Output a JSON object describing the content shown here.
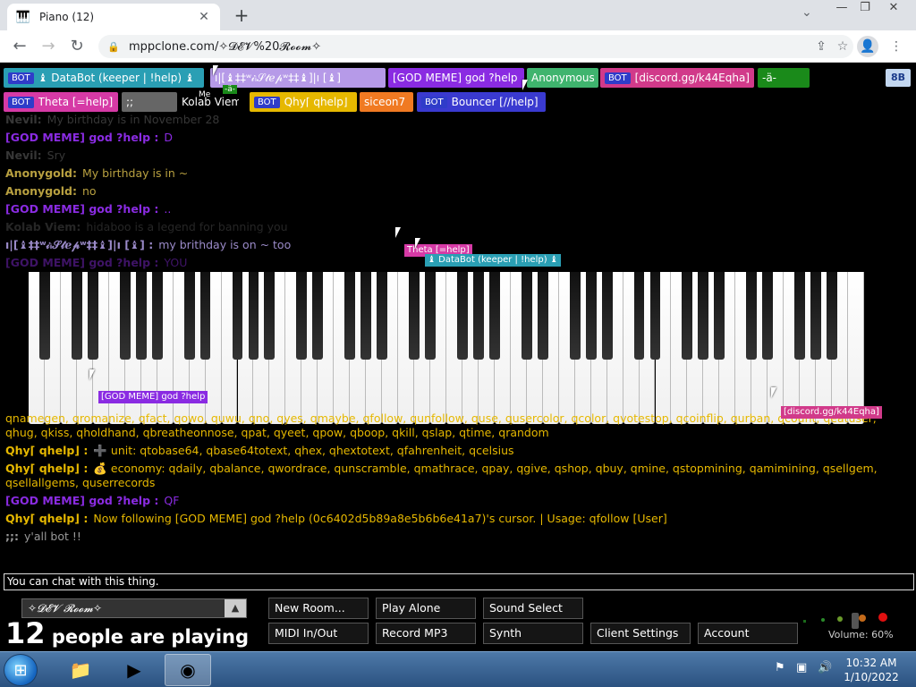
{
  "browser": {
    "tab_title": "Piano (12)",
    "url": "mppclone.com/✧𝓓𝓔𝓥%20𝓡𝓸𝓸𝓶✧"
  },
  "users": [
    {
      "bot": "BOT",
      "label": "♝ DataBot (keeper | !help) ♝",
      "color": "#2a9fb4"
    },
    {
      "bot": "",
      "label": "ı|[♝‡‡ʷ𝒾ᵢ𝒮𝓉ℯ𝓅ʷ‡‡♝]|ı [♝]",
      "color": "#b69ae8"
    },
    {
      "bot": "",
      "label": "[GOD MEME] god ?help",
      "color": "#8a2be2"
    },
    {
      "bot": "",
      "label": "Anonymous",
      "color": "#3fb46e"
    },
    {
      "bot": "BOT",
      "label": "[discord.gg/k44Eqha]",
      "color": "#d13a8a"
    },
    {
      "bot": "",
      "label": "-ä-",
      "color": "#1a8a1a"
    },
    {
      "bot": "BOT",
      "label": "Theta [=help]",
      "color": "#d63aa6"
    },
    {
      "bot": "",
      "label": ";;",
      "color": "#666666"
    },
    {
      "bot": "",
      "label": "Kolab Viem",
      "color": "#000000"
    },
    {
      "bot": "BOT",
      "label": "Qhy⌈ qhelp⌋",
      "color": "#e6b800"
    },
    {
      "bot": "",
      "label": "siceon7",
      "color": "#f07a22"
    },
    {
      "bot": "BOT",
      "label": "Bouncer [//help]",
      "color": "#3a3ad0"
    }
  ],
  "small_badges": {
    "me": "Me",
    "a": "-ä-",
    "sb": "8B"
  },
  "chat": [
    {
      "name": "Nevil:",
      "text": "My birthday is in November 28",
      "color": "#7a7a7a",
      "fade": true
    },
    {
      "name": "[GOD MEME] god ?help :",
      "text": "D",
      "color": "#8a2be2",
      "fade": false
    },
    {
      "name": "Nevil:",
      "text": "Sry",
      "color": "#7a7a7a",
      "fade": true
    },
    {
      "name": "Anonygold:",
      "text": "My birthday is in ~",
      "color": "#b8a040",
      "fade": false
    },
    {
      "name": "Anonygold:",
      "text": "no",
      "color": "#b8a040",
      "fade": false
    },
    {
      "name": "[GOD MEME] god ?help :",
      "text": "..",
      "color": "#8a2be2",
      "fade": false
    },
    {
      "name": "Kolab Viem:",
      "text": "hidaboo is a legend for banning you",
      "color": "#555555",
      "fade": true
    },
    {
      "name": "ı|[♝‡‡ʷ𝒾ᵢ𝒮𝓉ℯ𝓅ʷ‡‡♝]|ı [♝] :",
      "text": "my brithday is on ~ too",
      "color": "#9a8ac8",
      "fade": false
    },
    {
      "name": "[GOD MEME] god ?help :",
      "text": "YOU",
      "color": "#8a2be2",
      "fade": true
    }
  ],
  "chat_lower": [
    {
      "name": "",
      "text": "qnamegen, qromanize, qfact, qowo, quwu, qno, qyes, qmaybe, qfollow, qunfollow, quse, qusercolor, qcolor, qvotestop, qcoinflip, qurban, qcount, qeatuser, qhug, qkiss, qholdhand, qbreatheonnose, qpat, qyeet, qpow, qboop, qkill, qslap, qtime, qrandom",
      "color": "#e6b800",
      "wrap": true
    },
    {
      "name": "Qhy⌈ qhelp⌋ :",
      "text": "➕ unit: qtobase64, qbase64totext, qhex, qhextotext, qfahrenheit, qcelsius",
      "color": "#e6b800",
      "wrap": false
    },
    {
      "name": "Qhy⌈ qhelp⌋ :",
      "text": "💰 economy: qdaily, qbalance, qwordrace, qunscramble, qmathrace, qpay, qgive, qshop, qbuy, qmine, qstopmining, qamimining, qsellgem, qsellallgems, quserrecords",
      "color": "#e6b800",
      "wrap": true
    },
    {
      "name": "[GOD MEME] god ?help :",
      "text": "QF",
      "color": "#8a2be2",
      "wrap": false
    },
    {
      "name": "Qhy⌈ qhelp⌋ :",
      "text": "Now following [GOD MEME] god ?help (0c6402d5b89a8e5b6b6e41a7)'s cursor. | Usage: qfollow [User]",
      "color": "#e6b800",
      "wrap": false
    },
    {
      "name": ";;:",
      "text": "y'all bot !!",
      "color": "#999999",
      "wrap": false
    }
  ],
  "cursors": [
    {
      "label": "Theta [=help]",
      "color": "#d63aa6"
    },
    {
      "label": "♝ DataBot (keeper | !help) ♝",
      "color": "#2a9fb4"
    },
    {
      "label": "[GOD MEME] god ?help",
      "color": "#8a2be2"
    },
    {
      "label": "[discord.gg/k44Eqha]",
      "color": "#d13a8a"
    }
  ],
  "chat_input_placeholder": "You can chat with this thing.",
  "room": {
    "name": "✧𝓓𝓔𝓥 𝓡𝓸𝓸𝓶✧",
    "playing_count": "12",
    "playing_text": "people are playing"
  },
  "buttons": {
    "new_room": "New Room...",
    "play_alone": "Play Alone",
    "sound_select": "Sound Select",
    "midi": "MIDI In/Out",
    "record": "Record MP3",
    "synth": "Synth",
    "client_settings": "Client Settings",
    "account": "Account"
  },
  "volume": "Volume: 60%",
  "clock": {
    "time": "10:32 AM",
    "date": "1/10/2022"
  }
}
